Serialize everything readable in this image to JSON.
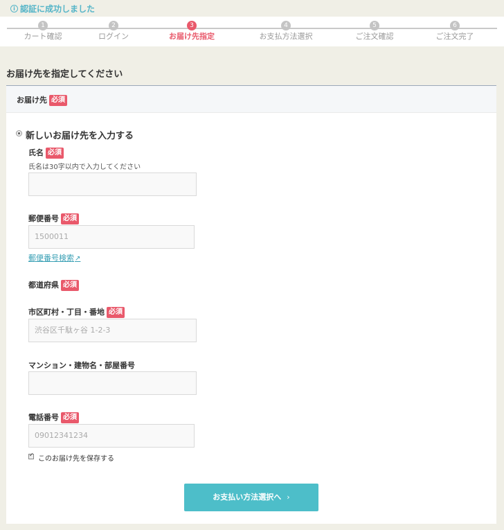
{
  "notice": {
    "icon": "info-icon",
    "text": "認証に成功しました"
  },
  "steps": [
    {
      "num": "1",
      "label": "カート確認",
      "active": false
    },
    {
      "num": "2",
      "label": "ログイン",
      "active": false
    },
    {
      "num": "3",
      "label": "お届け先指定",
      "active": true
    },
    {
      "num": "4",
      "label": "お支払方法選択",
      "active": false
    },
    {
      "num": "5",
      "label": "ご注文確認",
      "active": false
    },
    {
      "num": "6",
      "label": "ご注文完了",
      "active": false
    }
  ],
  "page": {
    "heading": "お届け先を指定してください"
  },
  "section": {
    "title": "お届け先",
    "required": "必須"
  },
  "option": {
    "label": "新しいお届け先を入力する"
  },
  "fields": {
    "name": {
      "label": "氏名",
      "required": "必須",
      "hint": "氏名は30字以内で入力してください",
      "value": ""
    },
    "postal": {
      "label": "郵便番号",
      "required": "必須",
      "placeholder": "1500011",
      "search_link": "郵便番号検索"
    },
    "prefecture": {
      "label": "都道府県",
      "required": "必須"
    },
    "address": {
      "label": "市区町村・丁目・番地",
      "required": "必須",
      "placeholder": "渋谷区千駄ヶ谷 1-2-3"
    },
    "building": {
      "label": "マンション・建物名・部屋番号",
      "value": ""
    },
    "phone": {
      "label": "電話番号",
      "required": "必須",
      "placeholder": "09012341234"
    }
  },
  "save": {
    "label": "このお届け先を保存する",
    "checked": true
  },
  "submit": {
    "label": "お支払い方法選択へ",
    "arrow": "›"
  },
  "colors": {
    "accent": "#e9596b",
    "primary": "#4dbec9",
    "link": "#3aa0b5"
  }
}
